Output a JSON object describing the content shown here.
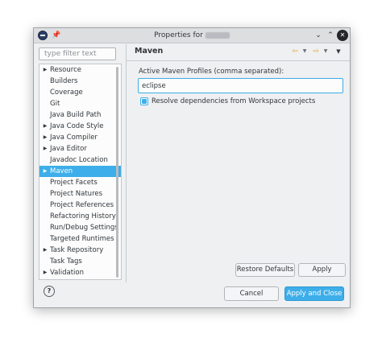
{
  "window": {
    "title": "Properties for"
  },
  "sidebar": {
    "filter_placeholder": "type filter text",
    "items": [
      {
        "label": "Resource",
        "expandable": true
      },
      {
        "label": "Builders",
        "expandable": false
      },
      {
        "label": "Coverage",
        "expandable": false
      },
      {
        "label": "Git",
        "expandable": false
      },
      {
        "label": "Java Build Path",
        "expandable": false
      },
      {
        "label": "Java Code Style",
        "expandable": true
      },
      {
        "label": "Java Compiler",
        "expandable": true
      },
      {
        "label": "Java Editor",
        "expandable": true
      },
      {
        "label": "Javadoc Location",
        "expandable": false
      },
      {
        "label": "Maven",
        "expandable": true,
        "selected": true
      },
      {
        "label": "Project Facets",
        "expandable": false
      },
      {
        "label": "Project Natures",
        "expandable": false
      },
      {
        "label": "Project References",
        "expandable": false
      },
      {
        "label": "Refactoring History",
        "expandable": false
      },
      {
        "label": "Run/Debug Settings",
        "expandable": false
      },
      {
        "label": "Targeted Runtimes",
        "expandable": false
      },
      {
        "label": "Task Repository",
        "expandable": true
      },
      {
        "label": "Task Tags",
        "expandable": false
      },
      {
        "label": "Validation",
        "expandable": true
      }
    ]
  },
  "page": {
    "title": "Maven",
    "profiles_label": "Active Maven Profiles (comma separated):",
    "profiles_value": "eclipse",
    "resolve_label": "Resolve dependencies from Workspace projects",
    "resolve_checked": true,
    "restore_defaults_label": "Restore Defaults",
    "apply_label": "Apply"
  },
  "footer": {
    "cancel_label": "Cancel",
    "apply_close_label": "Apply and Close"
  },
  "colors": {
    "accent": "#3daee9",
    "nav_arrow": "#e8a23a"
  }
}
